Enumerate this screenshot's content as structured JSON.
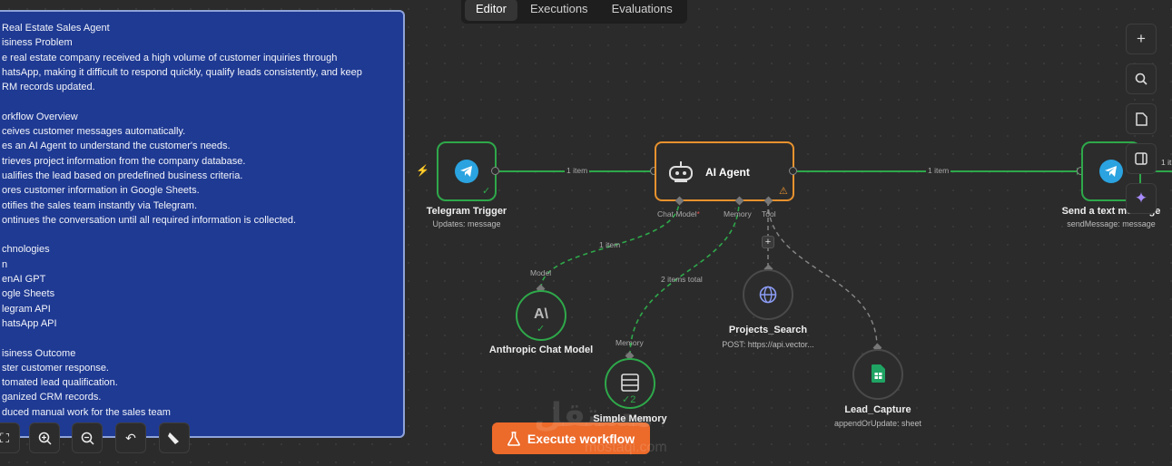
{
  "note": {
    "lines": [
      "Real Estate Sales Agent",
      "isiness Problem",
      "e real estate company received a high volume of customer inquiries through",
      "hatsApp, making it difficult to respond quickly, qualify leads consistently, and keep",
      "RM records updated.",
      "",
      "orkflow Overview",
      "ceives customer messages automatically.",
      "es an AI Agent to understand the customer's needs.",
      "trieves project information from the company database.",
      "ualifies the lead based on predefined business criteria.",
      "ores customer information in Google Sheets.",
      "otifies the sales team instantly via Telegram.",
      "ontinues the conversation until all required information is collected.",
      "",
      "chnologies",
      "n",
      "enAI GPT",
      "ogle Sheets",
      "legram API",
      "hatsApp API",
      "",
      "isiness Outcome",
      "ster customer response.",
      "tomated lead qualification.",
      "ganized CRM records.",
      "duced manual work for the sales team"
    ]
  },
  "tabs": [
    "Editor",
    "Executions",
    "Evaluations"
  ],
  "nodes": {
    "telegram_trigger": {
      "title": "Telegram Trigger",
      "subtitle": "Updates: message"
    },
    "ai_agent": {
      "title": "AI Agent",
      "port_chat_model": "Chat Model",
      "required_mark": "*",
      "port_memory": "Memory",
      "port_tool": "Tool"
    },
    "send_message": {
      "title": "Send a text message",
      "subtitle": "sendMessage: message",
      "edge_label": "1 it"
    },
    "anthropic": {
      "title": "Anthropic Chat Model",
      "port": "Model",
      "logo": "A\\"
    },
    "memory": {
      "title": "Simple Memory",
      "port": "Memory",
      "count": "2"
    },
    "projects_search": {
      "title": "Projects_Search",
      "subtitle": "POST: https://api.vector..."
    },
    "lead_capture": {
      "title": "Lead_Capture",
      "subtitle": "appendOrUpdate: sheet"
    }
  },
  "edges": {
    "trigger_to_agent": "1 item",
    "agent_to_send": "1 item",
    "model_to_agent": "1 item",
    "memory_to_agent": "2 items total"
  },
  "execute_button": "Execute workflow",
  "watermark": {
    "text_ar": "مستقل",
    "text_en": "mostaql.com"
  },
  "right_toolbar": [
    "plus-icon",
    "search-icon",
    "sticky-note-icon",
    "panel-icon",
    "sparkle-icon"
  ],
  "bottom_toolbar": [
    "fit-view-icon",
    "zoom-in-icon",
    "zoom-out-icon",
    "reset-icon",
    "tidy-up-icon"
  ],
  "colors": {
    "note_bg": "#1f3a93",
    "accent": "#ec6a2a",
    "success": "#2ea84a",
    "agent_border": "#e8922e",
    "telegram": "#2aa3e0",
    "sheets": "#1fa463"
  }
}
